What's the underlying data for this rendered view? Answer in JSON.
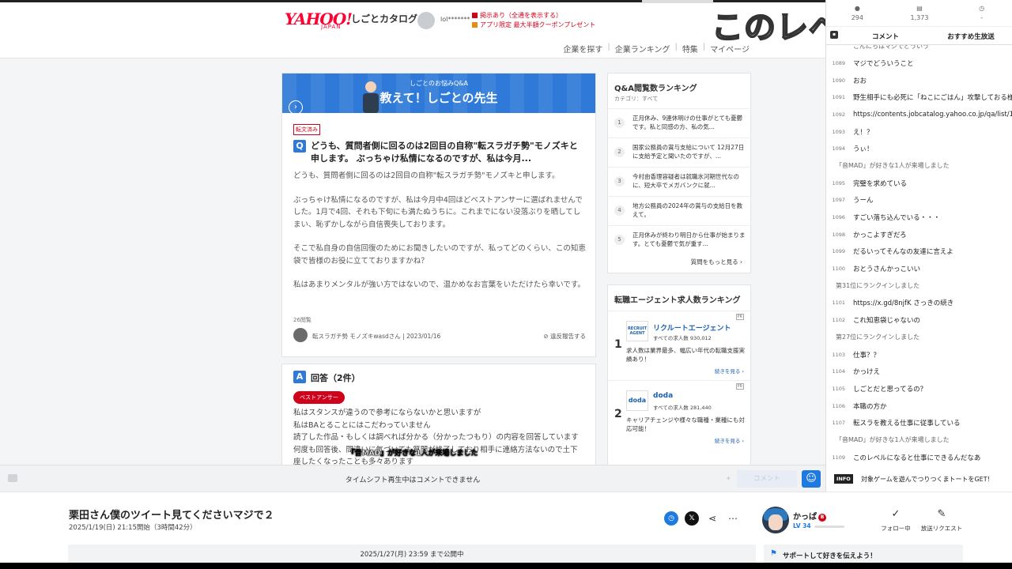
{
  "colors": {
    "accent": "#1f7ae0",
    "yahoo_red": "#ff0033",
    "qa_blue": "#2f7ad8",
    "badge_red": "#d0021b"
  },
  "site": {
    "logo": "YAHOO!",
    "logo_sub": "JAPAN",
    "catalog": "しごとカタログ",
    "user": "lol*******",
    "notice1": "掲示あり（全通を表示する）",
    "notice2": "アプリ限定 最大半額クーポンプレゼント",
    "nav": [
      "企業を探す",
      "企業ランキング",
      "特集",
      "マイページ"
    ]
  },
  "overlay_text": "このレベ",
  "banner": {
    "small": "しごとのお悩みQ&A",
    "big": "教えて！しごとの先生",
    "arrow": "›"
  },
  "question": {
    "tag": "転文済み",
    "mark": "Q",
    "title": "どうも、質問者側に回るのは2回目の自称\"転スラガチ勢\"モノズキと申します。 ぶっちゃけ私情になるのですが、私は今月...",
    "body": [
      "どうも、質問者側に回るのは2回目の自称\"転スラガチ勢\"モノズキと申します。",
      "ぶっちゃけ私情になるのですが、私は今月中4回ほどベストアンサーに選ばれませんでした。1月で4回、それも下旬にも満たぬうちに。これまでにない没落ぶりを晒してしまい、恥ずかしながら自信喪失しております。",
      "そこで私自身の自信回復のためにお聞きしたいのですが、私ってどのくらい、この知恵袋で皆様のお役に立てておりますかね？",
      "私はあまりメンタルが強い方ではないので、温かめなお言葉をいただけたら幸いです。"
    ],
    "views": "26閲覧",
    "author": "転スラガチ勢 モノズキwasdさん",
    "date": "2023/01/16",
    "report": "違反報告する"
  },
  "answers": {
    "mark": "A",
    "title": "回答（2件）",
    "best_label": "ベストアンサー",
    "body": [
      "私はスタンスが違うので参考にならないかと思いますが",
      "私はBAとることにはこだわっていません",
      "読了した作品・もしくは調べれば分かる（分かったつもり）の内容を回答しています",
      "何度も回答後、間違いに気づいても質問が終了しており相手に連絡方法ないので土下",
      "座したくなったことも多々あります"
    ]
  },
  "subtitle_overlay": "『音MAD』が好きな1人が来場しました",
  "qa_ranking": {
    "title": "Q&A閲覧数ランキング",
    "category": "カテゴリ：すべて",
    "items": [
      {
        "num": "1",
        "text": "正月休み、9連休明けの仕事がとても憂鬱です。私と同感の方、私の気..."
      },
      {
        "num": "2",
        "text": "国家公務員の賞与支給について 12月27日に支給予定と聞いたのですが、..."
      },
      {
        "num": "3",
        "text": "今村由香理容疑者は就職氷河期世代なのに、短大卒でメガバンクに就..."
      },
      {
        "num": "4",
        "text": "地方公務員の2024年の賞与の支給日を教えて。"
      },
      {
        "num": "5",
        "text": "正月休みが終わり明日から仕事が始まります。とても憂鬱で気が重す..."
      }
    ],
    "more": "質問をもっと見る ›"
  },
  "agent_ranking": {
    "title": "転職エージェント求人数ランキング",
    "items": [
      {
        "rank": "1",
        "logo": "RECRUIT AGENT",
        "name": "リクルートエージェント",
        "count": "すべての求人数 930,012",
        "desc": "求人数は業界最多、幅広い年代の転職支援実績あり！",
        "more": "続きを見る ›",
        "pr": "PR"
      },
      {
        "rank": "2",
        "logo": "doda",
        "name": "doda",
        "count": "すべての求人数 281,440",
        "desc": "キャリアチェンジや様々な職種・業種にも対応可能！",
        "more": "続きを見る ›",
        "pr": "PR"
      }
    ]
  },
  "panel": {
    "stats": [
      {
        "icon": "person-icon",
        "glyph": "👤",
        "value": "294"
      },
      {
        "icon": "comment-count-icon",
        "glyph": "▤",
        "value": "1,373"
      },
      {
        "icon": "clock-icon",
        "glyph": "◷",
        "value": "-"
      }
    ],
    "tab_comments": "コメント",
    "tab_recommend": "おすすめ生放送",
    "top_partial": "こんにちはマジでどういう",
    "comments": [
      {
        "no": "1089",
        "text": "マジでどういうこと"
      },
      {
        "no": "1090",
        "text": "おお"
      },
      {
        "no": "1091",
        "text": "野生相手にも必死に「ねこにごはん」攻撃しておる様"
      },
      {
        "no": "1092",
        "text": "https://contents.jobcatalog.yahoo.co.jp/qa/list/14"
      },
      {
        "no": "1093",
        "text": "え！？"
      },
      {
        "no": "1094",
        "text": "うぃ！"
      },
      {
        "no": "",
        "text": "「音MAD」が好きな1人が来場しました"
      },
      {
        "no": "1095",
        "text": "完璧を求めている"
      },
      {
        "no": "1097",
        "text": "うーん"
      },
      {
        "no": "1096",
        "text": "すごい落ち込んでいる・・・"
      },
      {
        "no": "1098",
        "text": "かっこよすぎだろ"
      },
      {
        "no": "1099",
        "text": "だるいってそんなの友達に言えよ"
      },
      {
        "no": "1100",
        "text": "おとうさんかっこいい"
      },
      {
        "no": "",
        "text": "第31位にランクインしました"
      },
      {
        "no": "1101",
        "text": "https://x.gd/8njfK さっきの続き"
      },
      {
        "no": "1102",
        "text": "これ知恵袋じゃないの"
      },
      {
        "no": "",
        "text": "第27位にランクインしました"
      },
      {
        "no": "1103",
        "text": "仕事？？"
      },
      {
        "no": "1104",
        "text": "かっけえ"
      },
      {
        "no": "1105",
        "text": "しごとだと思ってるの？"
      },
      {
        "no": "1106",
        "text": "本職の方か"
      },
      {
        "no": "1107",
        "text": "転スラを教える仕事に従事している"
      },
      {
        "no": "",
        "text": "「音MAD」が好きな1人が来場しました"
      },
      {
        "no": "1109",
        "text": "このレベルになると仕事にできるんだなあ"
      }
    ],
    "info_badge": "INFO",
    "info_text": "対象ゲームを遊んでつりつくまトートをGET！"
  },
  "input_bar": {
    "notice": "タイムシフト再生中はコメントできません",
    "send": "コメント"
  },
  "program": {
    "title": "栗田さん僕のツイート見てくださいマジで２",
    "date": "2025/1/19(日) 21:15開始（3時間42分）",
    "user": "かっぱ",
    "user_badge": "B",
    "level": "LV 34",
    "follow": "フォロー中",
    "request": "放送リクエスト",
    "open_until": "2025/1/27(月) 23:59 まで公開中",
    "support": "サポートして好きを伝えよう！"
  }
}
